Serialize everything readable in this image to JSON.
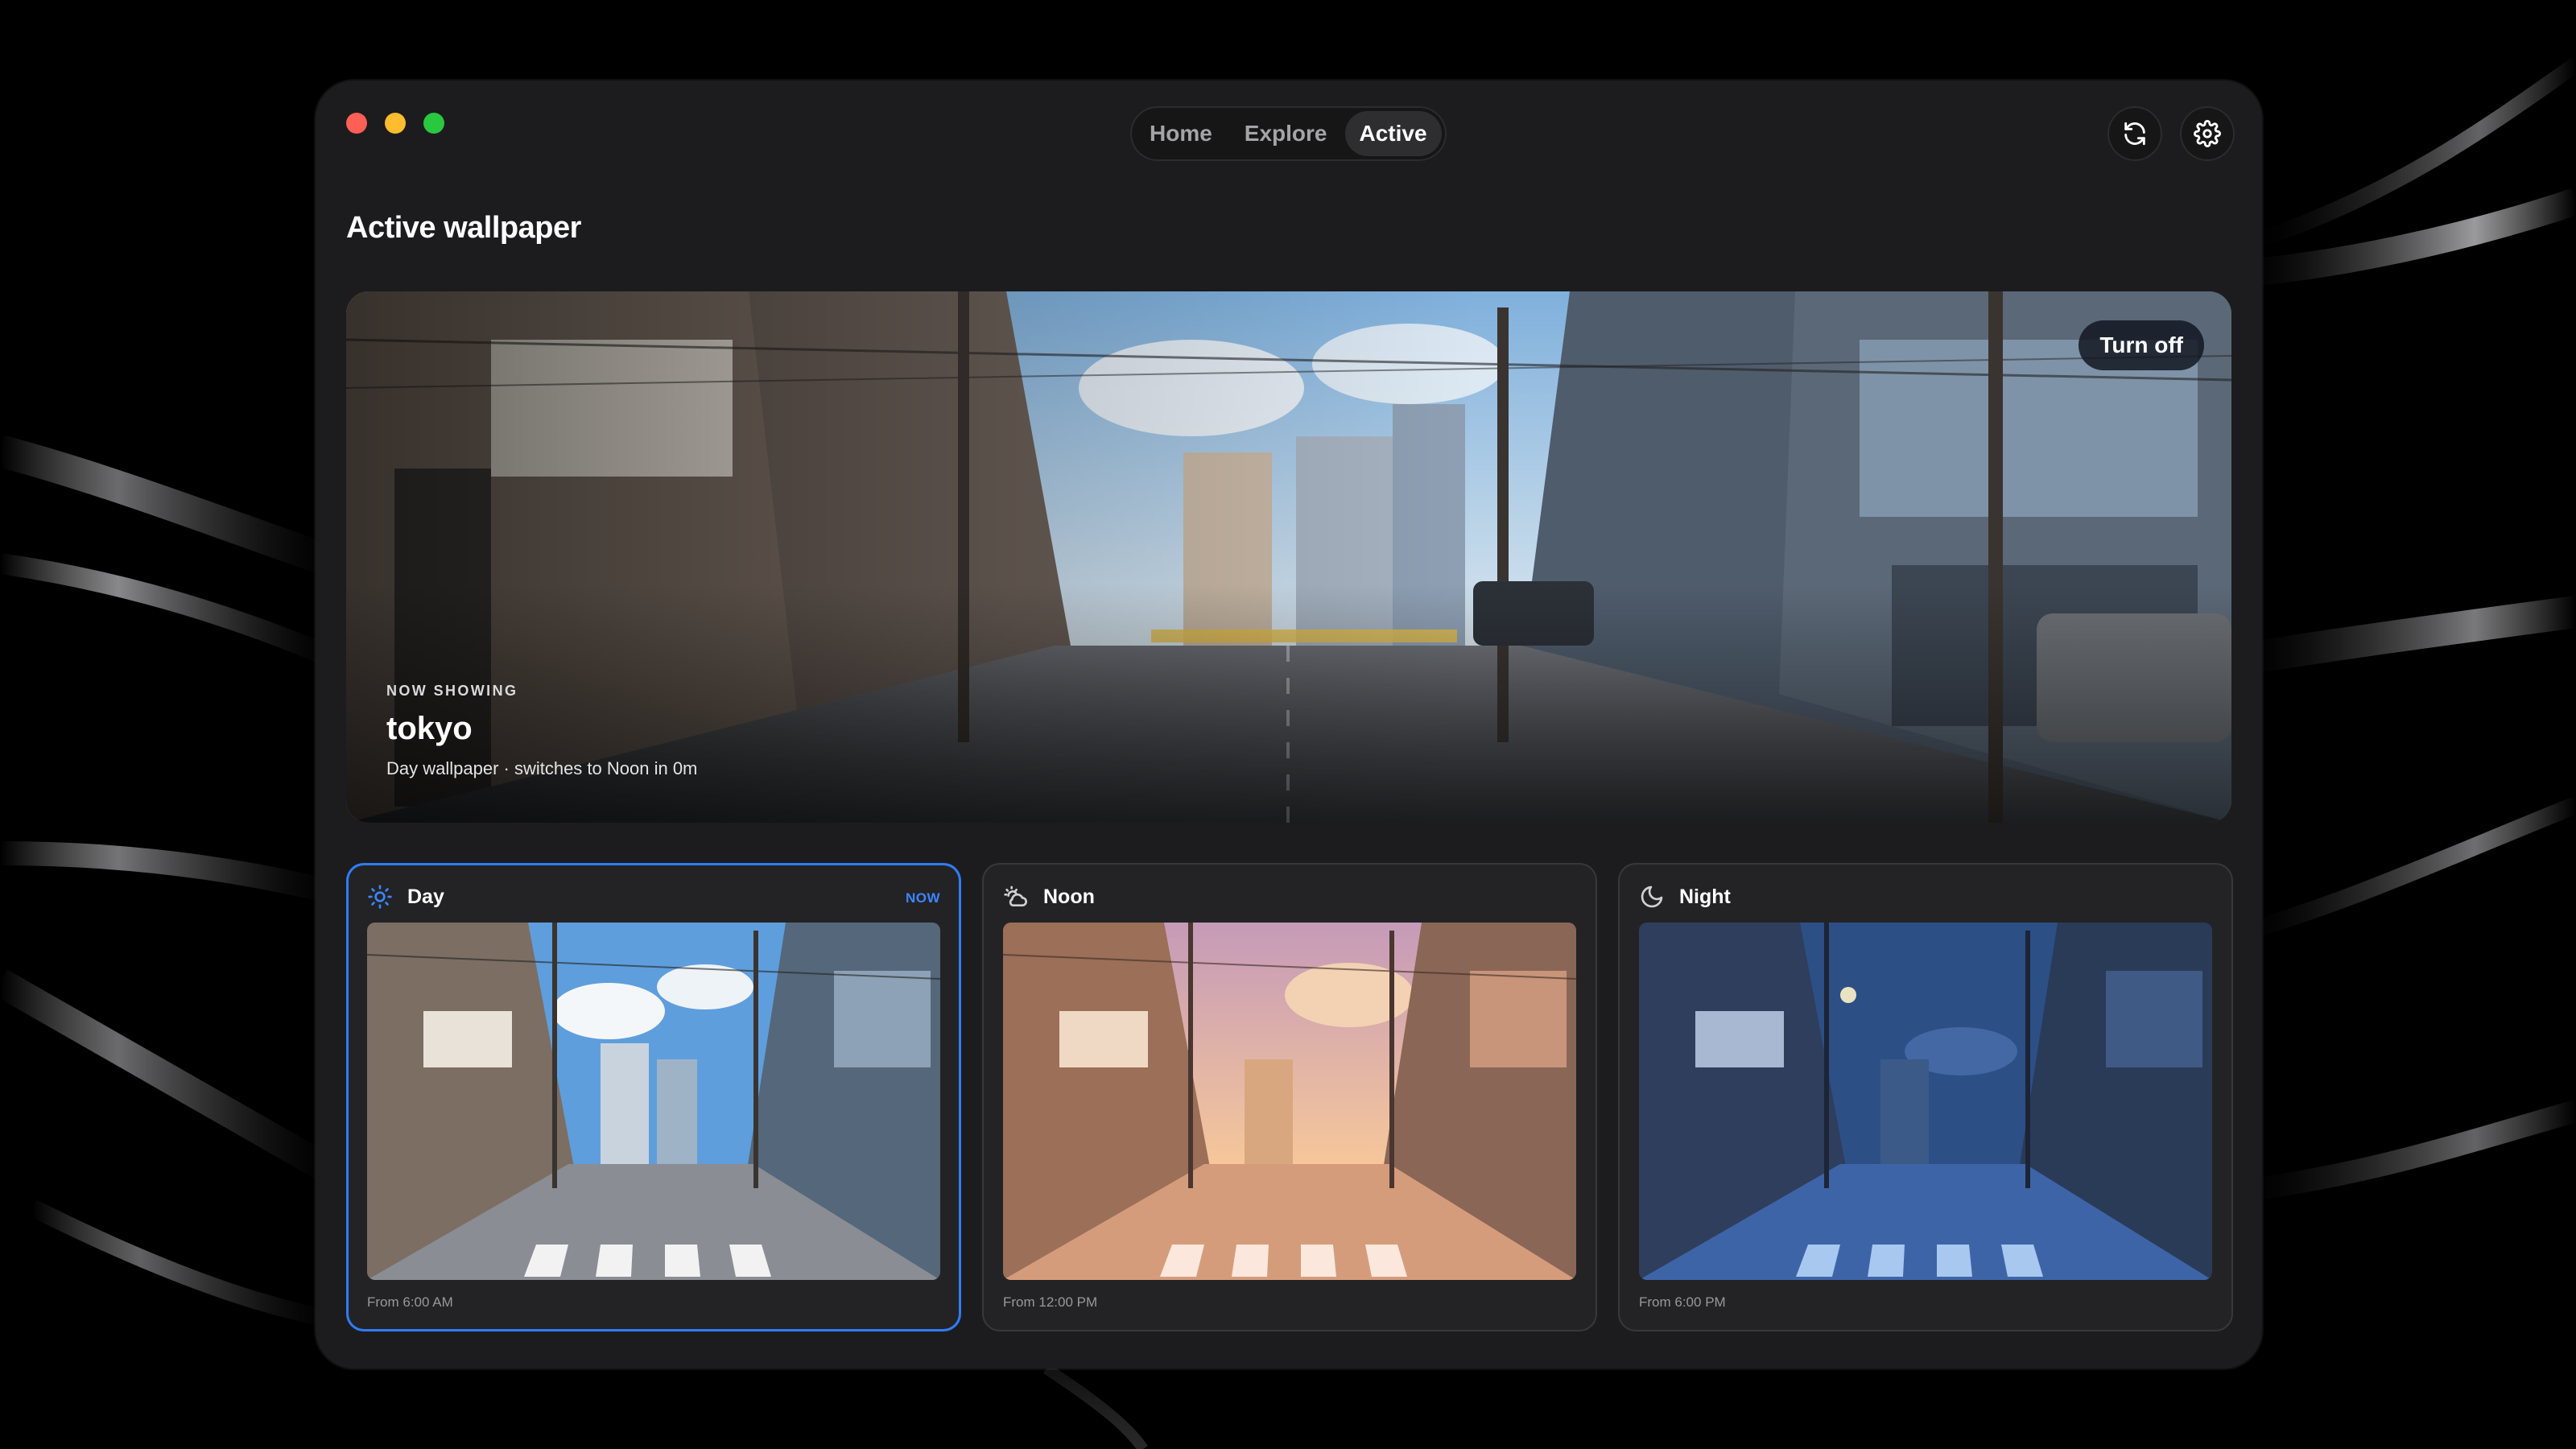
{
  "window": {
    "traffic_lights": [
      "close",
      "minimize",
      "maximize"
    ]
  },
  "nav": {
    "tabs": [
      {
        "label": "Home",
        "active": false
      },
      {
        "label": "Explore",
        "active": false
      },
      {
        "label": "Active",
        "active": true
      }
    ]
  },
  "toolbar": {
    "refresh_icon": "refresh-icon",
    "settings_icon": "gear-icon"
  },
  "page": {
    "title": "Active wallpaper"
  },
  "hero": {
    "turn_off_label": "Turn off",
    "eyebrow": "NOW SHOWING",
    "name": "tokyo",
    "subtitle": "Day wallpaper · switches to Noon in 0m"
  },
  "phases": [
    {
      "name": "Day",
      "icon": "sun-icon",
      "badge": "NOW",
      "time_label": "From 6:00 AM",
      "current": true
    },
    {
      "name": "Noon",
      "icon": "sun-cloud-icon",
      "badge": "",
      "time_label": "From 12:00 PM",
      "current": false
    },
    {
      "name": "Night",
      "icon": "moon-icon",
      "badge": "",
      "time_label": "From 6:00 PM",
      "current": false
    }
  ],
  "colors": {
    "accent": "#2f7cf6",
    "window_bg": "#1c1c1e",
    "card_bg": "#232325",
    "traffic_close": "#ff5f57",
    "traffic_min": "#febc2e",
    "traffic_max": "#28c840"
  }
}
